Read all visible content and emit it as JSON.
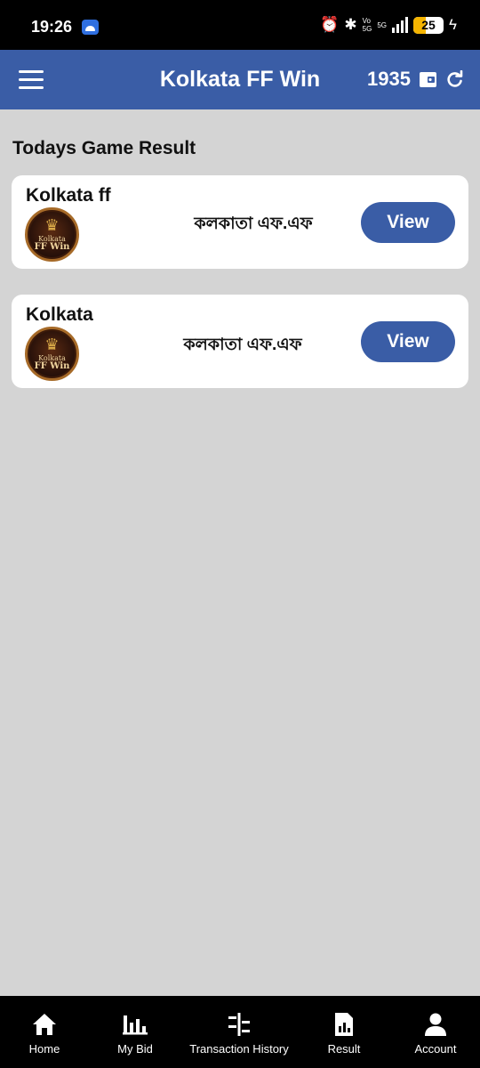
{
  "status_bar": {
    "time": "19:26",
    "network_small_top": "Vo",
    "network_small_bottom": "5G",
    "network_type": "5G",
    "battery_level": "25"
  },
  "header": {
    "title": "Kolkata FF Win",
    "balance": "1935"
  },
  "main": {
    "section_title": "Todays Game Result",
    "games": [
      {
        "name": "Kolkata ff",
        "subtitle": "কলকাতা এফ.এফ",
        "logo_line1": "Kolkata",
        "logo_line2": "FF Win",
        "button_label": "View"
      },
      {
        "name": "Kolkata",
        "subtitle": "কলকাতা এফ.এফ",
        "logo_line1": "Kolkata",
        "logo_line2": "FF Win",
        "button_label": "View"
      }
    ]
  },
  "bottom_nav": {
    "items": [
      {
        "label": "Home",
        "icon": "home-icon"
      },
      {
        "label": "My Bid",
        "icon": "bar-chart-icon"
      },
      {
        "label": "Transaction History",
        "icon": "transactions-icon"
      },
      {
        "label": "Result",
        "icon": "result-icon"
      },
      {
        "label": "Account",
        "icon": "account-icon"
      }
    ]
  },
  "colors": {
    "brand": "#3a5da6",
    "background": "#d4d4d4",
    "card": "#ffffff",
    "nav": "#000000"
  }
}
